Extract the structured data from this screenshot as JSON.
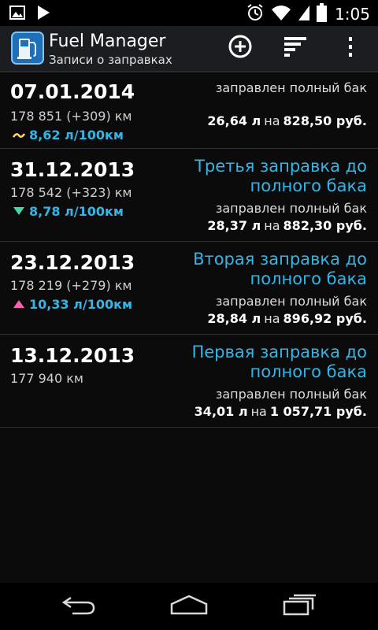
{
  "status_bar": {
    "time": "1:05",
    "icons": [
      "image-icon",
      "play-icon",
      "alarm-icon",
      "wifi-icon",
      "signal-icon",
      "battery-icon"
    ]
  },
  "action_bar": {
    "title": "Fuel Manager",
    "subtitle": "Записи о заправках",
    "actions": [
      "add-icon",
      "sort-icon",
      "overflow-menu-icon"
    ]
  },
  "entries": [
    {
      "date": "07.01.2014",
      "odometer": "178 851 (+309) км",
      "consumption": "8,62 л/100км",
      "trend": "same",
      "note": "",
      "fill_status": "заправлен полный бак",
      "liters": "26,64 л",
      "on": "на",
      "cost": "828,50 руб."
    },
    {
      "date": "31.12.2013",
      "odometer": "178 542 (+323) км",
      "consumption": "8,78 л/100км",
      "trend": "down",
      "note": "Третья заправка до полного бака",
      "fill_status": "заправлен полный бак",
      "liters": "28,37 л",
      "on": "на",
      "cost": "882,30 руб."
    },
    {
      "date": "23.12.2013",
      "odometer": "178 219 (+279) км",
      "consumption": "10,33 л/100км",
      "trend": "up",
      "note": "Вторая заправка до полного бака",
      "fill_status": "заправлен полный бак",
      "liters": "28,84 л",
      "on": "на",
      "cost": "896,92 руб."
    },
    {
      "date": "13.12.2013",
      "odometer": "177 940 км",
      "consumption": "",
      "trend": "",
      "note": "Первая заправка до полного бака",
      "fill_status": "заправлен полный бак",
      "liters": "34,01 л",
      "on": "на",
      "cost": "1 057,71 руб."
    }
  ],
  "colors": {
    "accent": "#33b5e5",
    "trend_same": "#ffd36a",
    "trend_down": "#4fd0a6",
    "trend_up": "#ff5fb3"
  },
  "nav_bar": [
    "back-icon",
    "home-icon",
    "recent-apps-icon"
  ]
}
